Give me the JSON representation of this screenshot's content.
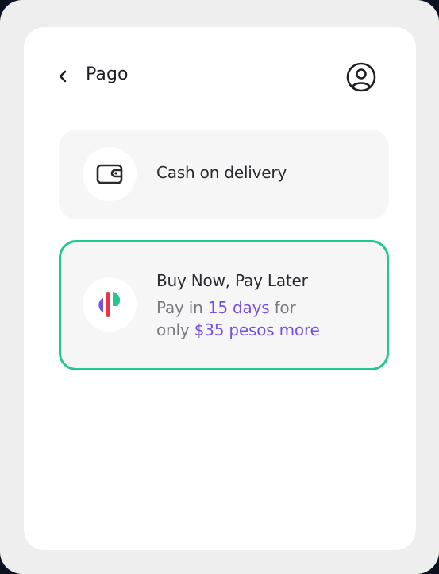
{
  "header": {
    "title": "Pago",
    "back_icon": "chevron-left-icon",
    "profile_icon": "user-circle-icon"
  },
  "options": [
    {
      "id": "cash",
      "icon": "wallet-icon",
      "label": "Cash on delivery",
      "selected": false
    },
    {
      "id": "bnpl",
      "icon": "bnpl-logo",
      "title": "Buy Now, Pay Later",
      "desc_part1": "Pay in ",
      "desc_highlight1": "15 days",
      "desc_part2": " for",
      "desc_part3": "only ",
      "desc_highlight2": "$35 pesos more",
      "selected": true
    }
  ],
  "colors": {
    "selected_border": "#22c98c",
    "highlight_text": "#7650e6",
    "logo_purple": "#7650e6",
    "logo_red": "#e8344e",
    "logo_green": "#22c98c"
  }
}
